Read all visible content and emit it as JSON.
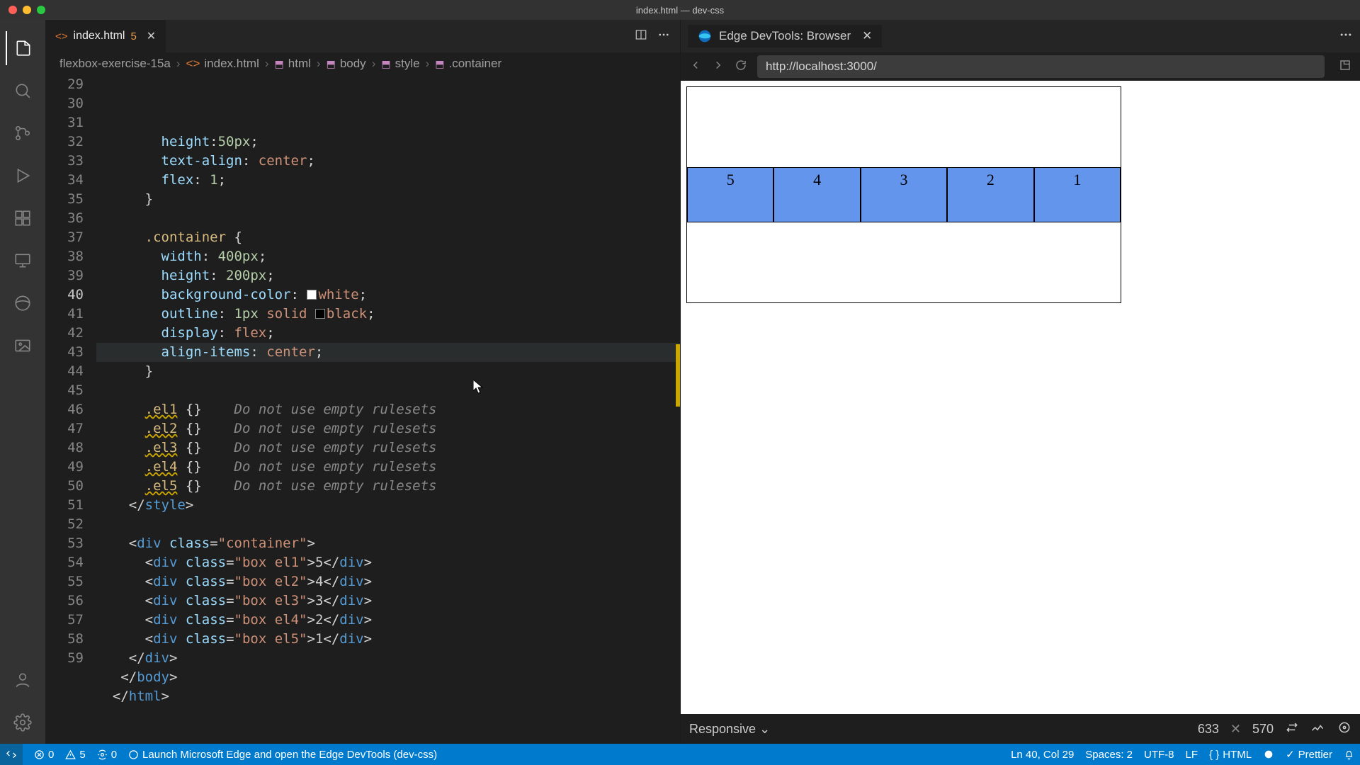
{
  "window": {
    "title": "index.html — dev-css"
  },
  "tab": {
    "filename": "index.html",
    "problemCount": "5"
  },
  "breadcrumb": [
    "flexbox-exercise-15a",
    "index.html",
    "html",
    "body",
    "style",
    ".container"
  ],
  "gutter": {
    "start": 29,
    "end": 59,
    "activeLine": 40
  },
  "code": {
    "l29": {
      "prop": "height",
      "val": "50px"
    },
    "l30": {
      "prop": "text-align",
      "val": "center"
    },
    "l31": {
      "prop": "flex",
      "val": "1"
    },
    "l34": {
      "sel": ".container"
    },
    "l35": {
      "prop": "width",
      "val": "400px"
    },
    "l36": {
      "prop": "height",
      "val": "200px"
    },
    "l37": {
      "prop": "background-color",
      "val": "white"
    },
    "l38": {
      "prop": "outline",
      "v1": "1px",
      "v2": "solid",
      "v3": "black"
    },
    "l39": {
      "prop": "display",
      "val": "flex"
    },
    "l40": {
      "prop": "align-items",
      "val": "center"
    },
    "l43": {
      "sel": ".el1",
      "hint": "Do not use empty rulesets"
    },
    "l44": {
      "sel": ".el2",
      "hint": "Do not use empty rulesets"
    },
    "l45": {
      "sel": ".el3",
      "hint": "Do not use empty rulesets"
    },
    "l46": {
      "sel": ".el4",
      "hint": "Do not use empty rulesets"
    },
    "l47": {
      "sel": ".el5",
      "hint": "Do not use empty rulesets"
    },
    "l48": {
      "tag": "style"
    },
    "l50": {
      "tag": "div",
      "cls": "container"
    },
    "l51": {
      "tag": "div",
      "cls": "box el1",
      "txt": "5"
    },
    "l52": {
      "tag": "div",
      "cls": "box el2",
      "txt": "4"
    },
    "l53": {
      "tag": "div",
      "cls": "box el3",
      "txt": "3"
    },
    "l54": {
      "tag": "div",
      "cls": "box el4",
      "txt": "2"
    },
    "l55": {
      "tag": "div",
      "cls": "box el5",
      "txt": "1"
    },
    "l56": {
      "tag": "div"
    },
    "l57": {
      "tag": "body"
    },
    "l58": {
      "tag": "html"
    }
  },
  "devtools": {
    "tabTitle": "Edge DevTools: Browser",
    "url": "http://localhost:3000/",
    "responsive": "Responsive",
    "width": "633",
    "height": "570"
  },
  "preview": {
    "boxes": [
      "5",
      "4",
      "3",
      "2",
      "1"
    ]
  },
  "status": {
    "errors": "0",
    "warnings": "5",
    "ports": "0",
    "launch": "Launch Microsoft Edge and open the Edge DevTools (dev-css)",
    "cursor": "Ln 40, Col 29",
    "spaces": "Spaces: 2",
    "encoding": "UTF-8",
    "eol": "LF",
    "lang": "HTML",
    "prettier": "Prettier"
  }
}
